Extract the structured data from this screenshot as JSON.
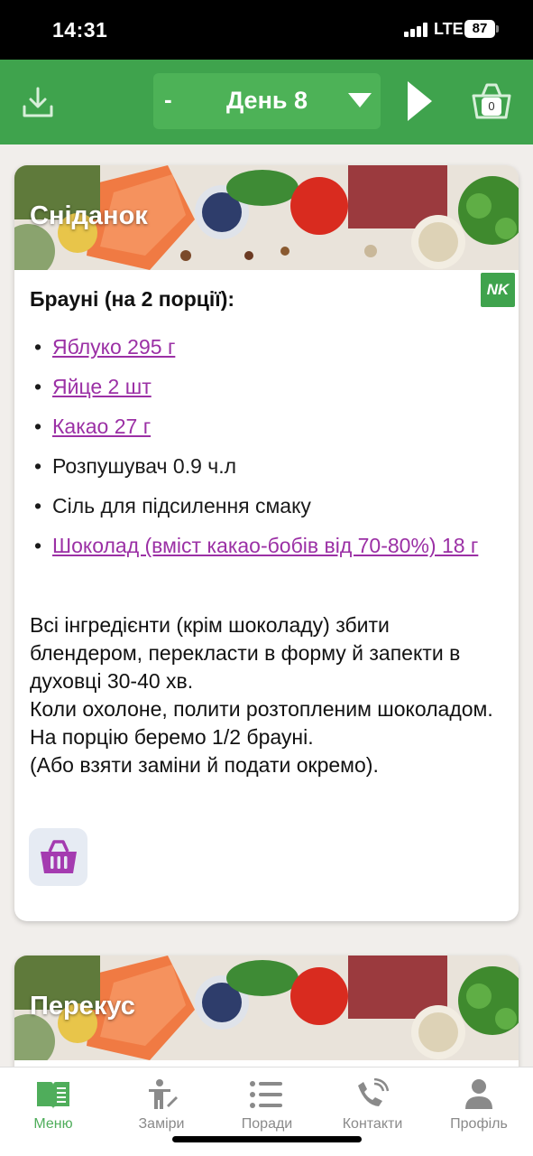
{
  "status_bar": {
    "time": "14:31",
    "network": "LTE",
    "battery": "87"
  },
  "header": {
    "day_minus": "-",
    "day_label": "День 8",
    "cart_count": "0"
  },
  "colors": {
    "brand_green": "#3fa34d",
    "link_purple": "#9b30a5"
  },
  "meals": [
    {
      "title": "Сніданок",
      "badge": "NK",
      "recipe_title": "Брауні (на 2 порції):",
      "ingredients": [
        {
          "text": "Яблуко 295 г",
          "link": true
        },
        {
          "text": "Яйце 2 шт",
          "link": true
        },
        {
          "text": "Какао 27 г",
          "link": true
        },
        {
          "text": "Розпушувач 0.9 ч.л",
          "link": false
        },
        {
          "text": "Сіль для підсилення смаку",
          "link": false
        },
        {
          "text": "Шоколад (вміст какао-бобів від 70-80%) 18 г",
          "link": true
        }
      ],
      "instructions": "Всі інгредієнти (крім шоколаду) збити блендером, перекласти в форму й запекти в духовці 30-40 хв.\nКоли охолоне, полити розтопленим шоколадом.\n На порцію беремо 1/2 брауні.\n (Або взяти заміни й подати окремо)."
    },
    {
      "title": "Перекус"
    }
  ],
  "tabs": [
    {
      "label": "Меню",
      "icon": "book-icon",
      "active": true
    },
    {
      "label": "Заміри",
      "icon": "measure-person-icon",
      "active": false
    },
    {
      "label": "Поради",
      "icon": "list-icon",
      "active": false
    },
    {
      "label": "Контакти",
      "icon": "contacts-icon",
      "active": false
    },
    {
      "label": "Профіль",
      "icon": "person-icon",
      "active": false
    }
  ]
}
